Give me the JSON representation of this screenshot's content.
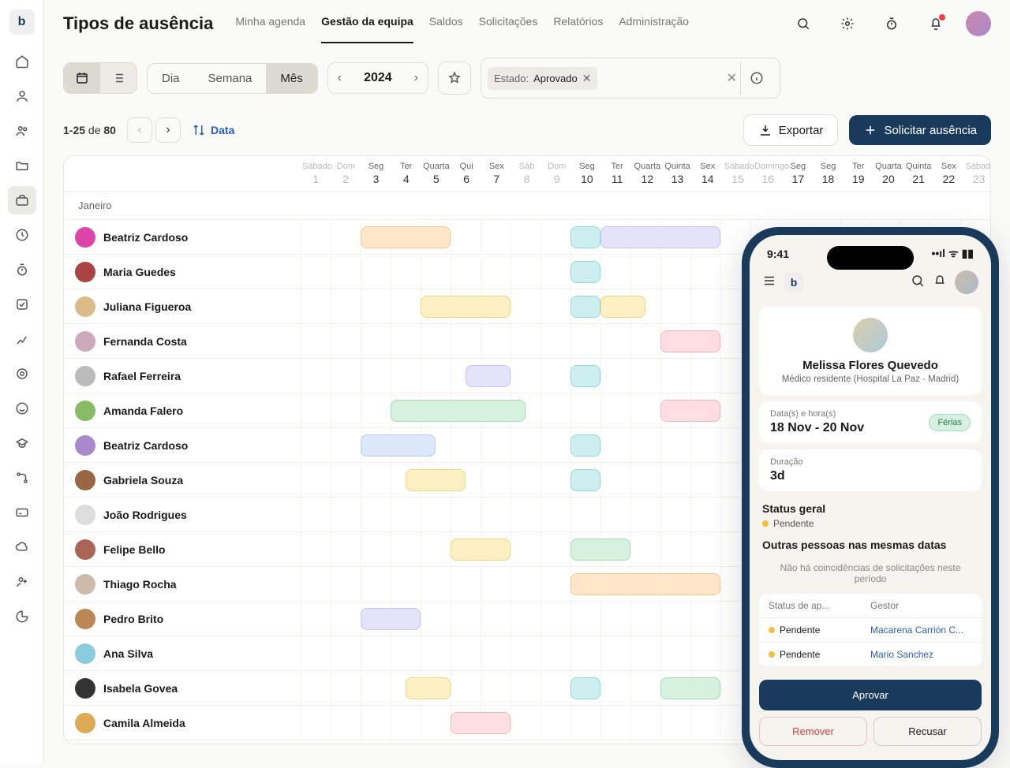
{
  "header": {
    "title": "Tipos de ausência",
    "tabs": [
      {
        "label": "Minha agenda"
      },
      {
        "label": "Gestão da equipa",
        "active": true
      },
      {
        "label": "Saldos"
      },
      {
        "label": "Solicitações"
      },
      {
        "label": "Relatórios"
      },
      {
        "label": "Administração"
      }
    ]
  },
  "controls": {
    "periods": [
      {
        "label": "Dia"
      },
      {
        "label": "Semana"
      },
      {
        "label": "Mês",
        "active": true
      }
    ],
    "year": "2024",
    "filter": {
      "key": "Estado:",
      "value": "Aprovado"
    }
  },
  "pagination": {
    "range": "1-25",
    "of_label": "de",
    "total": "80"
  },
  "sort_label": "Data",
  "export_label": "Exportar",
  "request_label": "Solicitar ausência",
  "calendar": {
    "month_label": "Janeiro",
    "days": [
      {
        "dow": "Sábado",
        "num": "1",
        "weekend": true
      },
      {
        "dow": "Dom",
        "num": "2",
        "weekend": true
      },
      {
        "dow": "Seg",
        "num": "3"
      },
      {
        "dow": "Ter",
        "num": "4"
      },
      {
        "dow": "Quarta",
        "num": "5"
      },
      {
        "dow": "Qui",
        "num": "6"
      },
      {
        "dow": "Sex",
        "num": "7"
      },
      {
        "dow": "Sáb",
        "num": "8",
        "weekend": true
      },
      {
        "dow": "Dom",
        "num": "9",
        "weekend": true
      },
      {
        "dow": "Seg",
        "num": "10"
      },
      {
        "dow": "Ter",
        "num": "11"
      },
      {
        "dow": "Quarta",
        "num": "12"
      },
      {
        "dow": "Quinta",
        "num": "13"
      },
      {
        "dow": "Sex",
        "num": "14"
      },
      {
        "dow": "Sábado",
        "num": "15",
        "weekend": true
      },
      {
        "dow": "Domingo",
        "num": "16",
        "weekend": true
      },
      {
        "dow": "Seg",
        "num": "17"
      },
      {
        "dow": "Seg",
        "num": "18"
      },
      {
        "dow": "Ter",
        "num": "19"
      },
      {
        "dow": "Quarta",
        "num": "20"
      },
      {
        "dow": "Quinta",
        "num": "21"
      },
      {
        "dow": "Sex",
        "num": "22"
      },
      {
        "dow": "Sábado",
        "num": "23",
        "weekend": true
      }
    ],
    "rows": [
      {
        "name": "Beatriz Cardoso",
        "avatar": "#d4a",
        "bars": [
          {
            "start": 2,
            "span": 3,
            "c": "c-orange"
          },
          {
            "start": 9,
            "span": 1,
            "c": "c-cyan"
          },
          {
            "start": 10,
            "span": 4,
            "c": "c-lilac"
          }
        ]
      },
      {
        "name": "Maria Guedes",
        "avatar": "#a44",
        "bars": [
          {
            "start": 9,
            "span": 1,
            "c": "c-cyan"
          }
        ]
      },
      {
        "name": "Juliana Figueroa",
        "avatar": "#db8",
        "bars": [
          {
            "start": 4,
            "span": 3,
            "c": "c-yellow"
          },
          {
            "start": 9,
            "span": 1,
            "c": "c-cyan"
          },
          {
            "start": 10,
            "span": 1.5,
            "c": "c-yellow"
          }
        ]
      },
      {
        "name": "Fernanda Costa",
        "avatar": "#cab",
        "bars": [
          {
            "start": 12,
            "span": 2,
            "c": "c-pink"
          }
        ]
      },
      {
        "name": "Rafael Ferreira",
        "avatar": "#bbb",
        "bars": [
          {
            "start": 5.5,
            "span": 1.5,
            "c": "c-lilac"
          },
          {
            "start": 9,
            "span": 1,
            "c": "c-cyan"
          }
        ]
      },
      {
        "name": "Amanda Falero",
        "avatar": "#8b6",
        "bars": [
          {
            "start": 3,
            "span": 4.5,
            "c": "c-green"
          },
          {
            "start": 12,
            "span": 2,
            "c": "c-pink"
          }
        ]
      },
      {
        "name": "Beatriz Cardoso",
        "avatar": "#a8c",
        "bars": [
          {
            "start": 2,
            "span": 2.5,
            "c": "c-blue"
          },
          {
            "start": 9,
            "span": 1,
            "c": "c-cyan"
          }
        ]
      },
      {
        "name": "Gabriela Souza",
        "avatar": "#964",
        "bars": [
          {
            "start": 3.5,
            "span": 2,
            "c": "c-yellow"
          },
          {
            "start": 9,
            "span": 1,
            "c": "c-cyan"
          }
        ]
      },
      {
        "name": "João Rodrigues",
        "avatar": "#ddd",
        "bars": []
      },
      {
        "name": "Felipe Bello",
        "avatar": "#a65",
        "bars": [
          {
            "start": 5,
            "span": 2,
            "c": "c-yellow"
          },
          {
            "start": 9,
            "span": 2,
            "c": "c-green"
          }
        ]
      },
      {
        "name": "Thiago Rocha",
        "avatar": "#cba",
        "bars": [
          {
            "start": 9,
            "span": 5,
            "c": "c-orange"
          }
        ]
      },
      {
        "name": "Pedro Brito",
        "avatar": "#b85",
        "bars": [
          {
            "start": 2,
            "span": 2,
            "c": "c-lilac"
          }
        ]
      },
      {
        "name": "Ana Silva",
        "avatar": "#8cd",
        "bars": []
      },
      {
        "name": "Isabela Govea",
        "avatar": "#333",
        "bars": [
          {
            "start": 3.5,
            "span": 1.5,
            "c": "c-yellow"
          },
          {
            "start": 9,
            "span": 1,
            "c": "c-cyan"
          },
          {
            "start": 12,
            "span": 2,
            "c": "c-green"
          }
        ]
      },
      {
        "name": "Camila Almeida",
        "avatar": "#da5",
        "bars": [
          {
            "start": 5,
            "span": 2,
            "c": "c-red"
          }
        ]
      }
    ]
  },
  "mobile": {
    "time": "9:41",
    "profile": {
      "name": "Melissa Flores Quevedo",
      "role": "Médico residente (Hospital La Paz - Madrid)"
    },
    "dates_label": "Data(s) e hora(s)",
    "dates_value": "18 Nov - 20 Nov",
    "badge": "Férias",
    "duration_label": "Duração",
    "duration_value": "3d",
    "status_title": "Status geral",
    "status_value": "Pendente",
    "overlap_title": "Outras pessoas nas mesmas datas",
    "overlap_empty": "Não  há coincidências de solicitações neste período",
    "approval_table": {
      "col_status": "Status de ap...",
      "col_manager": "Gestor",
      "rows": [
        {
          "status": "Pendente",
          "manager": "Macarena Carrión C..."
        },
        {
          "status": "Pendente",
          "manager": "Mario Sanchez"
        }
      ]
    },
    "actions": {
      "approve": "Aprovar",
      "remove": "Remover",
      "reject": "Recusar"
    }
  }
}
